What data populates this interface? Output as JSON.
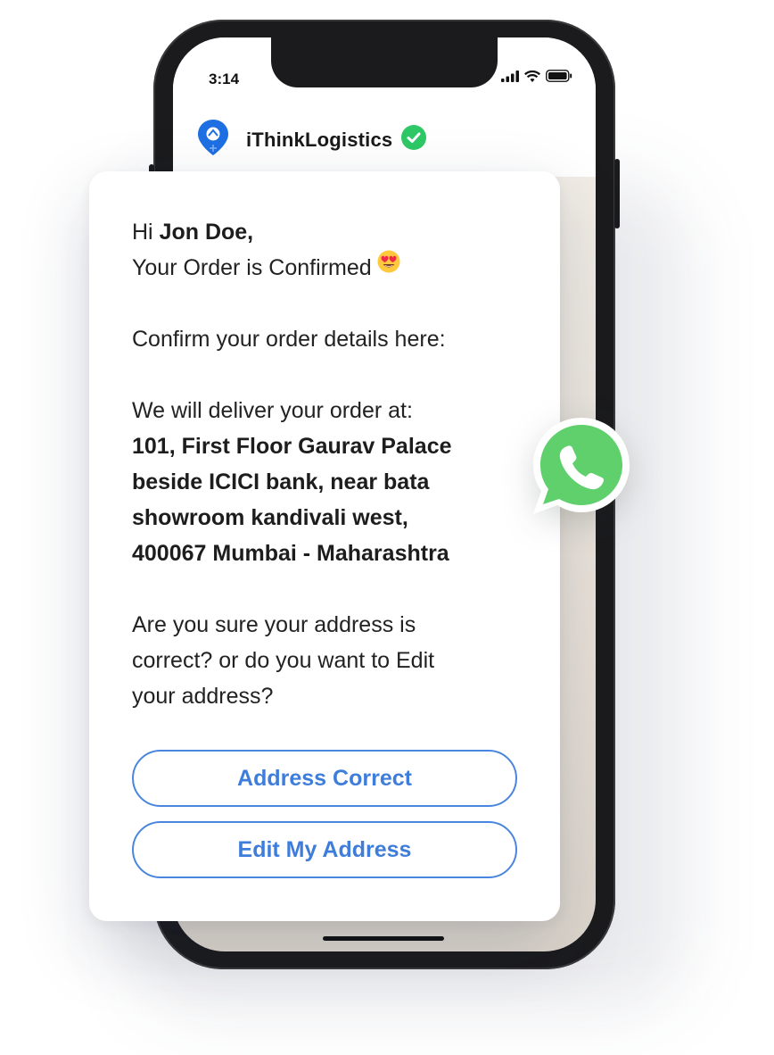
{
  "status_bar": {
    "time": "3:14"
  },
  "chat_header": {
    "brand_name": "iThinkLogistics"
  },
  "message": {
    "greeting_prefix": "Hi ",
    "customer_name": "Jon Doe,",
    "order_confirmed": "Your Order is Confirmed",
    "confirm_details": "Confirm your order details here:",
    "deliver_intro": "We will deliver your order at:",
    "address_line1": "101, First Floor Gaurav Palace",
    "address_line2": "beside ICICI bank, near bata",
    "address_line3": "showroom kandivali west,",
    "address_line4": "400067 Mumbai - Maharashtra",
    "question_line1": "Are you sure your address is",
    "question_line2": "correct? or do you want to Edit",
    "question_line3": "your address?"
  },
  "buttons": {
    "address_correct": "Address Correct",
    "edit_address": "Edit My Address"
  },
  "icons": {
    "brand_logo": "location-pin-logo-icon",
    "verified": "verified-check-icon",
    "emoji": "heart-eyes-emoji-icon",
    "whatsapp": "whatsapp-icon",
    "signal": "signal-icon",
    "wifi": "wifi-icon",
    "battery": "battery-icon"
  },
  "colors": {
    "accent_blue": "#3f7ddb",
    "verified_green": "#2ec866",
    "whatsapp_green": "#5fd06b"
  }
}
